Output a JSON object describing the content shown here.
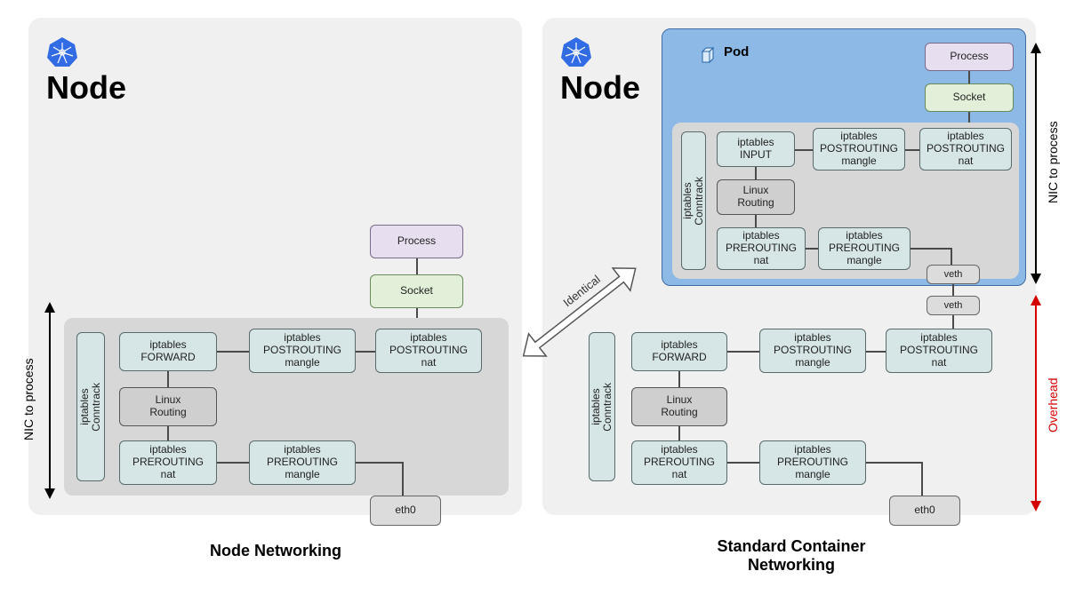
{
  "left": {
    "title": "Node",
    "caption": "Node Networking",
    "side_label": "NIC to process",
    "process": "Process",
    "socket": "Socket",
    "eth0": "eth0",
    "conntrack": "iptables\nConntrack",
    "linux_routing": "Linux\nRouting",
    "ipt_forward": "iptables\nFORWARD",
    "ipt_post_mangle": "iptables\nPOSTROUTING\nmangle",
    "ipt_post_nat": "iptables\nPOSTROUTING\nnat",
    "ipt_pre_nat": "iptables\nPREROUTING\nnat",
    "ipt_pre_mangle": "iptables\nPREROUTING\nmangle"
  },
  "right": {
    "title": "Node",
    "caption": "Standard Container\nNetworking",
    "side_label_top": "NIC to process",
    "side_label_bottom": "Overhead",
    "pod_label": "Pod",
    "process": "Process",
    "socket": "Socket",
    "veth": "veth",
    "eth0": "eth0",
    "conntrack": "iptables\nConntrack",
    "linux_routing": "Linux\nRouting",
    "ipt_input": "iptables\nINPUT",
    "ipt_forward": "iptables\nFORWARD",
    "ipt_post_mangle": "iptables\nPOSTROUTING\nmangle",
    "ipt_post_nat": "iptables\nPOSTROUTING\nnat",
    "ipt_pre_nat": "iptables\nPREROUTING\nnat",
    "ipt_pre_mangle": "iptables\nPREROUTING\nmangle"
  },
  "identical_label": "Identical",
  "colors": {
    "teal": "#d6e5e5",
    "gray": "#dcdcdc",
    "purple": "#e7dff0",
    "green": "#e2f0d9",
    "pod": "#8cb9e6",
    "overhead_arrow": "#d40000"
  }
}
